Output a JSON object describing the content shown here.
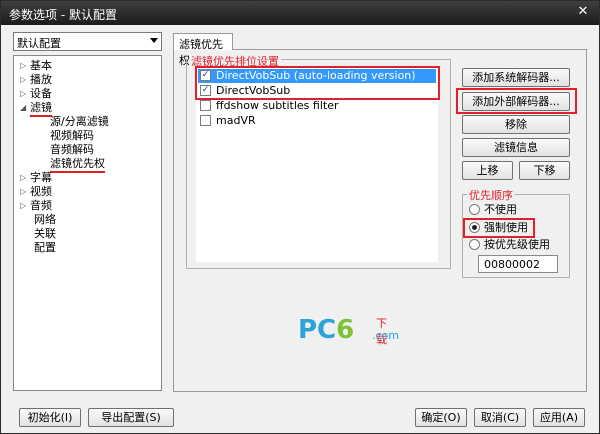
{
  "window": {
    "title": "参数选项 - 默认配置",
    "close_glyph": "✕"
  },
  "profile": {
    "selected": "默认配置"
  },
  "tree": {
    "items": [
      {
        "label": "基本",
        "expander": "▷"
      },
      {
        "label": "播放",
        "expander": "▷"
      },
      {
        "label": "设备",
        "expander": "▷"
      },
      {
        "label": "滤镜",
        "expander": "◢"
      },
      {
        "label": "源/分离滤镜",
        "expander": ""
      },
      {
        "label": "视频解码",
        "expander": ""
      },
      {
        "label": "音频解码",
        "expander": ""
      },
      {
        "label": "滤镜优先权",
        "expander": ""
      },
      {
        "label": "字幕",
        "expander": "▷"
      },
      {
        "label": "视频",
        "expander": "▷"
      },
      {
        "label": "音频",
        "expander": "▷"
      },
      {
        "label": "网络",
        "expander": ""
      },
      {
        "label": "关联",
        "expander": ""
      },
      {
        "label": "配置",
        "expander": ""
      }
    ]
  },
  "tab": {
    "label": "滤镜优先权"
  },
  "filters_group": {
    "title": "滤镜优先排位设置",
    "items": [
      {
        "label": "DirectVobSub (auto-loading version)",
        "checked": "✓"
      },
      {
        "label": "DirectVobSub",
        "checked": "✓"
      },
      {
        "label": "ffdshow subtitles filter",
        "checked": ""
      },
      {
        "label": "madVR",
        "checked": ""
      }
    ]
  },
  "buttons": {
    "add_system": "添加系统解码器...",
    "add_external": "添加外部解码器...",
    "remove": "移除",
    "filter_info": "滤镜信息",
    "move_up": "上移",
    "move_down": "下移"
  },
  "priority_group": {
    "title": "优先顺序",
    "options": [
      "不使用",
      "强制使用",
      "按优先级使用"
    ],
    "selected": "强制使用",
    "value": "00800002"
  },
  "watermark": {
    "pc": "PC",
    "six": "6",
    "download": "下载",
    "com": ".com"
  },
  "footer": {
    "init": "初始化(I)",
    "export": "导出配置(S)",
    "ok": "确定(O)",
    "cancel": "取消(C)",
    "apply": "应用(A)"
  },
  "colors": {
    "accent_red": "#e0202a",
    "selection_blue": "#3399ff"
  }
}
